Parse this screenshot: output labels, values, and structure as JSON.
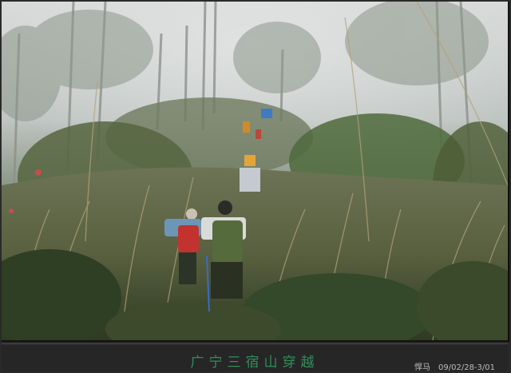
{
  "caption": {
    "title": "广宁三宿山穿越",
    "author": "悍马",
    "date": "09/02/28-3/01"
  },
  "photo": {
    "subject": "hikers-in-misty-forest"
  },
  "colors": {
    "fog": "#cfd3d1",
    "foliage": "#3f5a32",
    "grass": "#9a8a68",
    "title": "#2f8f5a"
  }
}
